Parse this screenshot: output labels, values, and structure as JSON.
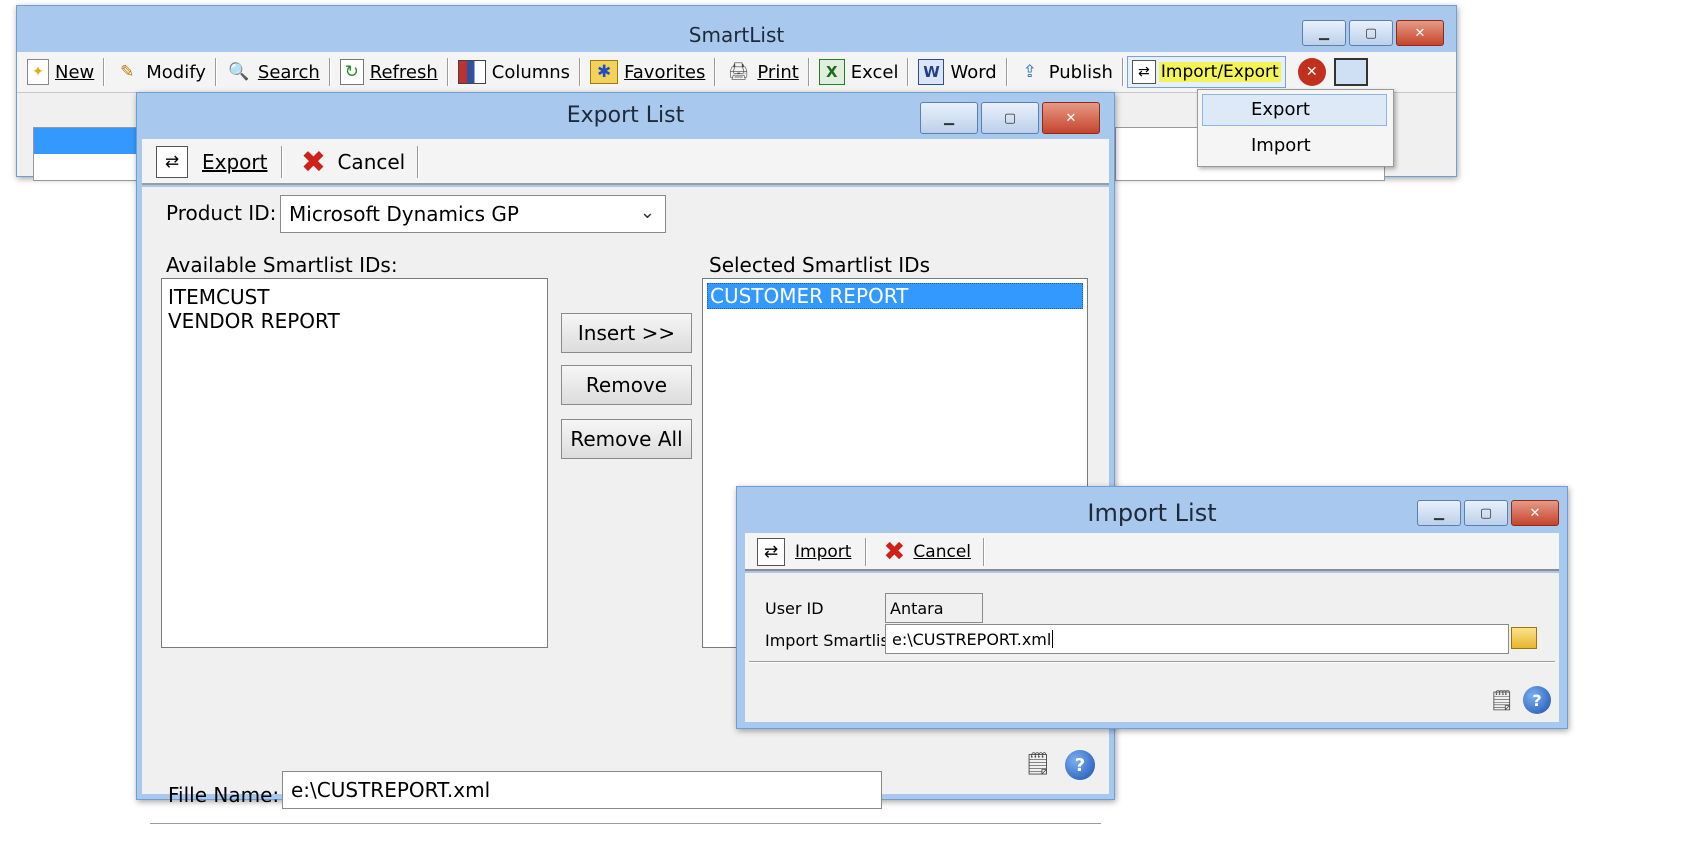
{
  "smartlist": {
    "title": "SmartList",
    "toolbar": [
      {
        "name": "new",
        "label": "New",
        "icon": "new-page-icon"
      },
      {
        "name": "modify",
        "label": "Modify",
        "icon": "pencil-icon"
      },
      {
        "name": "search",
        "label": "Search",
        "icon": "magnifier-icon"
      },
      {
        "name": "refresh",
        "label": "Refresh",
        "icon": "refresh-icon"
      },
      {
        "name": "columns",
        "label": "Columns",
        "icon": "columns-icon"
      },
      {
        "name": "favorites",
        "label": "Favorites",
        "icon": "star-folder-icon"
      },
      {
        "name": "print",
        "label": "Print",
        "icon": "printer-icon"
      },
      {
        "name": "excel",
        "label": "Excel",
        "icon": "excel-icon"
      },
      {
        "name": "word",
        "label": "Word",
        "icon": "word-icon"
      },
      {
        "name": "publish",
        "label": "Publish",
        "icon": "publish-icon"
      },
      {
        "name": "import-export",
        "label": "Import/Export",
        "icon": "import-export-icon"
      }
    ],
    "dropdown": [
      "Export",
      "Import"
    ]
  },
  "export_list": {
    "title": "Export List",
    "export_label": "Export",
    "cancel_label": "Cancel",
    "product_id_label": "Product ID:",
    "product_id_value": "Microsoft Dynamics GP",
    "available_label": "Available Smartlist IDs:",
    "available_items": [
      "ITEMCUST",
      "VENDOR REPORT"
    ],
    "selected_label": "Selected Smartlist IDs",
    "selected_items": [
      "CUSTOMER REPORT"
    ],
    "insert_label": "Insert >>",
    "remove_label": "Remove",
    "remove_all_label": "Remove All",
    "file_name_label": "Fille Name:",
    "file_name_value": "e:\\CUSTREPORT.xml"
  },
  "import_list": {
    "title": "Import List",
    "import_label": "Import",
    "cancel_label": "Cancel",
    "user_id_label": "User ID",
    "user_id_value": "Antara",
    "import_smartlist_label": "Import Smartlist",
    "import_smartlist_value": "e:\\CUSTREPORT.xml"
  },
  "colors": {
    "title_blue": "#a9c8ee",
    "selection": "#3399ff",
    "highlight": "#f3f35a",
    "close_red": "#c6442c"
  }
}
